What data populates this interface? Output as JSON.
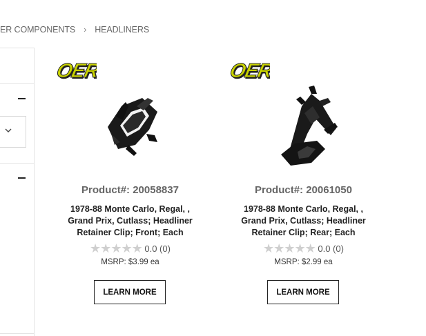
{
  "breadcrumb": {
    "items": [
      "ER COMPONENTS",
      "HEADLINERS"
    ],
    "separator": "›"
  },
  "colors": {
    "logo_yellow": "#c8d200",
    "logo_shadow": "#222222",
    "star_empty": "#cfcfcf",
    "button_border": "#222222"
  },
  "products": [
    {
      "brand_logo": "OER",
      "product_number": "Product#: 20058837",
      "name": "1978-88 Monte Carlo, Regal, , Grand Prix, Cutlass; Headliner Retainer Clip; Front; Each",
      "stars": "★★★★★",
      "rating_text": "0.0 (0)",
      "rating_value": 0,
      "msrp": "MSRP: $3.99 ea",
      "button_label": "LEARN MORE",
      "image_icon": "headliner-clip-front-image"
    },
    {
      "brand_logo": "OER",
      "product_number": "Product#: 20061050",
      "name": "1978-88 Monte Carlo, Regal, , Grand Prix, Cutlass; Headliner Retainer Clip; Rear; Each",
      "stars": "★★★★★",
      "rating_text": "0.0 (0)",
      "rating_value": 0,
      "msrp": "MSRP: $2.99 ea",
      "button_label": "LEARN MORE",
      "image_icon": "headliner-clip-rear-image"
    }
  ]
}
